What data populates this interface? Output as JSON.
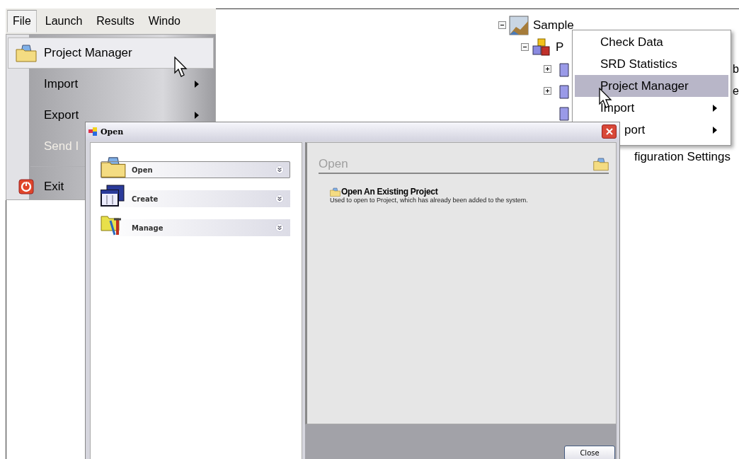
{
  "menu_bar": [
    {
      "label": "File",
      "selected": true
    },
    {
      "label": "Launch",
      "selected": false
    },
    {
      "label": "Results",
      "selected": false
    },
    {
      "label": "Windo",
      "selected": false
    }
  ],
  "file_menu": [
    {
      "kind": "item",
      "label": "Project Manager",
      "highlighted": true,
      "submenu": false,
      "disabled": false
    },
    {
      "kind": "item",
      "label": "Import",
      "highlighted": false,
      "submenu": true,
      "disabled": false
    },
    {
      "kind": "item",
      "label": "Export",
      "highlighted": false,
      "submenu": true,
      "disabled": false
    },
    {
      "kind": "item",
      "label": "Send I",
      "highlighted": false,
      "disabled": true
    },
    {
      "kind": "separator"
    },
    {
      "kind": "item",
      "label": "Exit",
      "highlighted": false,
      "disabled": false
    }
  ],
  "tree": [
    {
      "kind": "node",
      "label": "Sample",
      "expanded": true,
      "children": [
        {
          "kind": "node",
          "label": "P",
          "expanded": true,
          "children": [
            {
              "kind": "cut",
              "label": "b",
              "expanded": false
            },
            {
              "kind": "cut",
              "label": "e",
              "expanded": false
            },
            {
              "kind": "leaf"
            },
            {
              "kind": "tail",
              "label": "figuration Settings"
            }
          ]
        }
      ]
    }
  ],
  "context_menu": [
    {
      "kind": "item",
      "label": "Check Data",
      "highlighted": false,
      "submenu": false
    },
    {
      "kind": "item",
      "label": "SRD Statistics",
      "highlighted": false,
      "submenu": false
    },
    {
      "kind": "item",
      "label": "Project Manager",
      "highlighted": true,
      "submenu": false
    },
    {
      "kind": "item",
      "label": "Import",
      "highlighted": false,
      "submenu": true
    },
    {
      "kind": "cut",
      "label": "port",
      "highlighted": false,
      "submenu": true
    }
  ],
  "dialog": {
    "title": "Open",
    "nav": [
      {
        "label": "Open",
        "selected": true
      },
      {
        "label": "Create",
        "selected": false
      },
      {
        "label": "Manage",
        "selected": false
      }
    ],
    "panel": {
      "heading": "Open",
      "tasks": [
        {
          "title": "Open An Existing Project",
          "description": "Used to open to Project, which has already been added to the system."
        }
      ]
    },
    "close_button": "Close"
  }
}
